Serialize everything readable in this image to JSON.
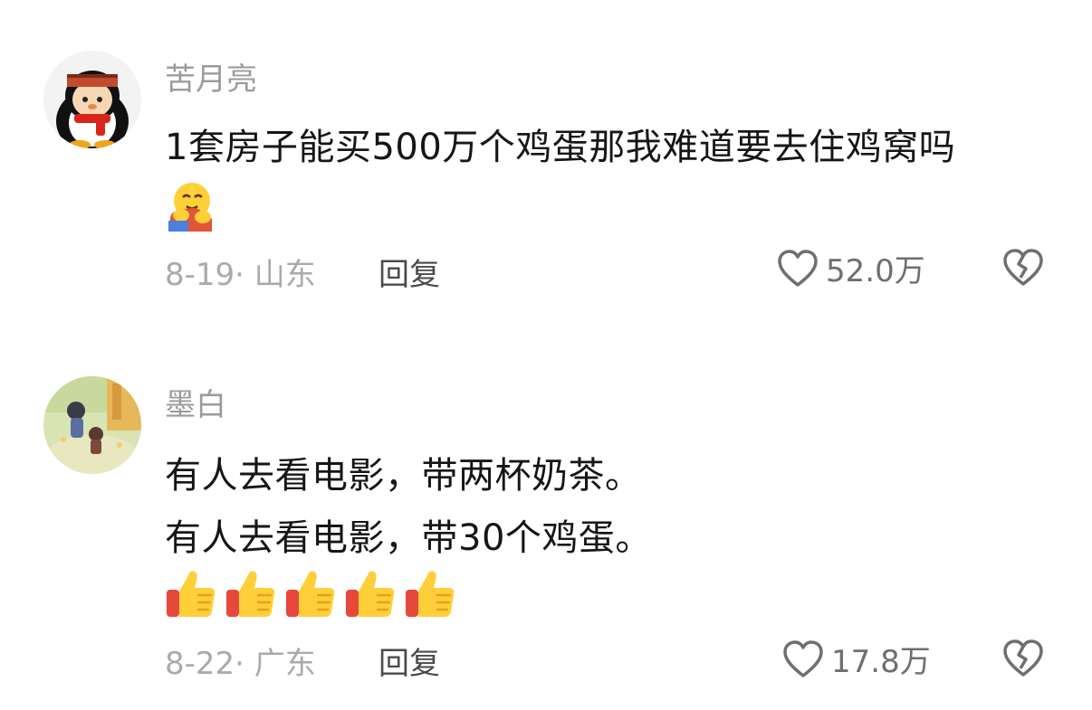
{
  "comments": [
    {
      "username": "苦月亮",
      "avatar_icon": "penguin-scarf-avatar-icon",
      "lines": [
        "1套房子能买500万个鸡蛋那我难道要去住鸡窝吗"
      ],
      "emojis": [
        "hugging-face-emoji"
      ],
      "meta": "8-19· 山东",
      "reply_label": "回复",
      "like_count": "52.0万"
    },
    {
      "username": "墨白",
      "avatar_icon": "anime-scene-avatar-icon",
      "lines": [
        "有人去看电影，带两杯奶茶。",
        "有人去看电影，带30个鸡蛋。"
      ],
      "emojis": [
        "thumbs-up-emoji",
        "thumbs-up-emoji",
        "thumbs-up-emoji",
        "thumbs-up-emoji",
        "thumbs-up-emoji"
      ],
      "meta": "8-22· 广东",
      "reply_label": "回复",
      "like_count": "17.8万"
    }
  ],
  "colors": {
    "username": "#9b9b9b",
    "text": "#161616",
    "meta": "#aaaaaa",
    "reply": "#4a4a4a",
    "icon": "#6f6f6f"
  }
}
